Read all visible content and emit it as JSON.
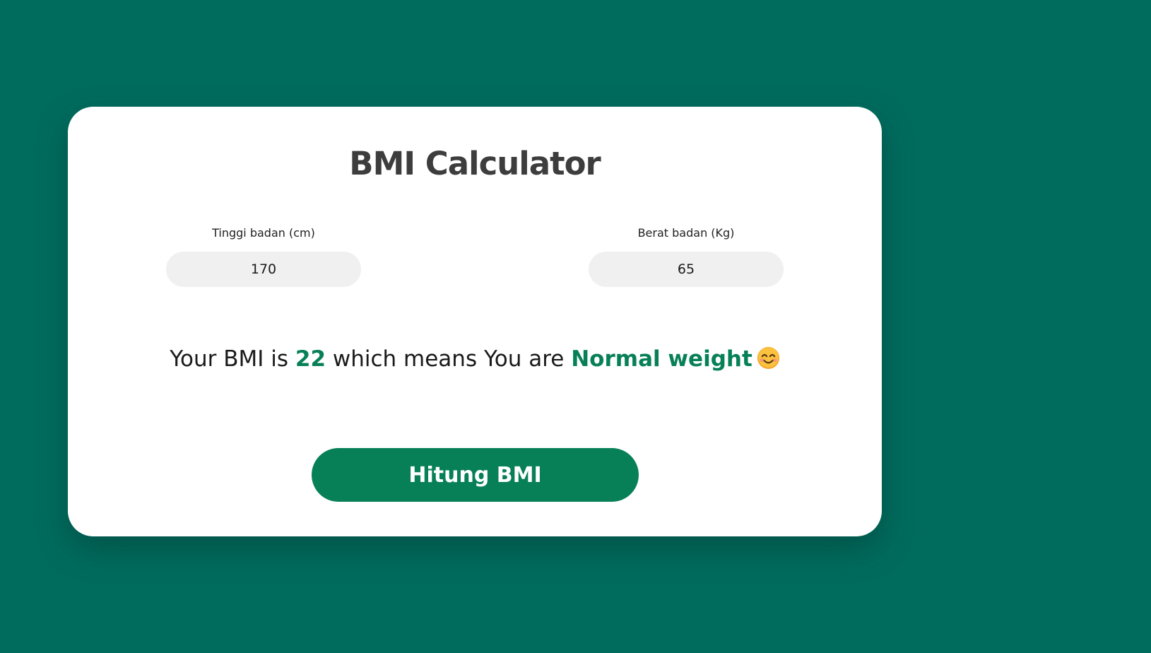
{
  "app": {
    "title": "BMI Calculator"
  },
  "form": {
    "height_label": "Tinggi badan (cm)",
    "height_value": "170",
    "weight_label": "Berat badan (Kg)",
    "weight_value": "65"
  },
  "result": {
    "prefix": "Your BMI is ",
    "bmi_value": "22",
    "middle": " which means You are ",
    "category": "Normal weight",
    "emoji_icon": "smiling-face-icon"
  },
  "action": {
    "button_label": "Hitung BMI"
  },
  "colors": {
    "background": "#006c5e",
    "accent": "#078057",
    "title_text": "#3d3d3d",
    "input_bg": "#f0f0f0"
  }
}
